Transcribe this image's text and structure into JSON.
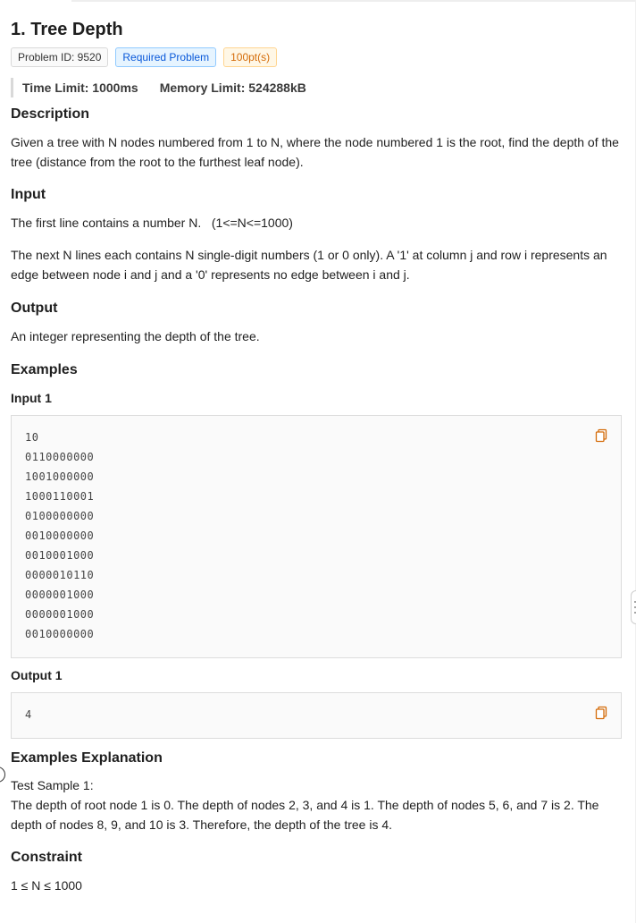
{
  "problem": {
    "title": "1. Tree Depth",
    "tags": {
      "id": "Problem ID: 9520",
      "required": "Required Problem",
      "points": "100pt(s)"
    },
    "limits": {
      "time": "Time Limit: 1000ms",
      "memory": "Memory Limit: 524288kB"
    }
  },
  "description": {
    "heading": "Description",
    "text": "Given a tree with N nodes numbered from 1 to N, where the node numbered 1 is the root, find the depth of the tree (distance from the root to the furthest leaf node)."
  },
  "input": {
    "heading": "Input",
    "line1": "The first line contains a number N.   (1<=N<=1000)",
    "line2": "The next N lines each contains N single-digit numbers (1 or 0 only). A '1' at column j and row i represents an edge between node i and j and a '0' represents no edge between i and j."
  },
  "output": {
    "heading": "Output",
    "text": "An integer representing the depth of the tree."
  },
  "examples": {
    "heading": "Examples",
    "input_label": "Input 1",
    "input_lines": [
      "10",
      "0110000000",
      "1001000000",
      "1000110001",
      "0100000000",
      "0010000000",
      "0010001000",
      "0000010110",
      "0000001000",
      "0000001000",
      "0010000000"
    ],
    "output_label": "Output 1",
    "output_lines": [
      "4"
    ]
  },
  "explanation": {
    "heading": "Examples Explanation",
    "line1": "Test Sample 1:",
    "line2": "The depth of root node 1 is 0. The depth of nodes 2, 3, and 4 is 1. The depth of nodes 5, 6, and 7 is 2. The depth of nodes 8, 9, and 10 is 3. Therefore, the depth of the tree is 4."
  },
  "constraint": {
    "heading": "Constraint",
    "text": "1 ≤ N ≤ 1000"
  },
  "icons": {
    "copy": "copy-icon",
    "copy_color": "#d46b08"
  }
}
